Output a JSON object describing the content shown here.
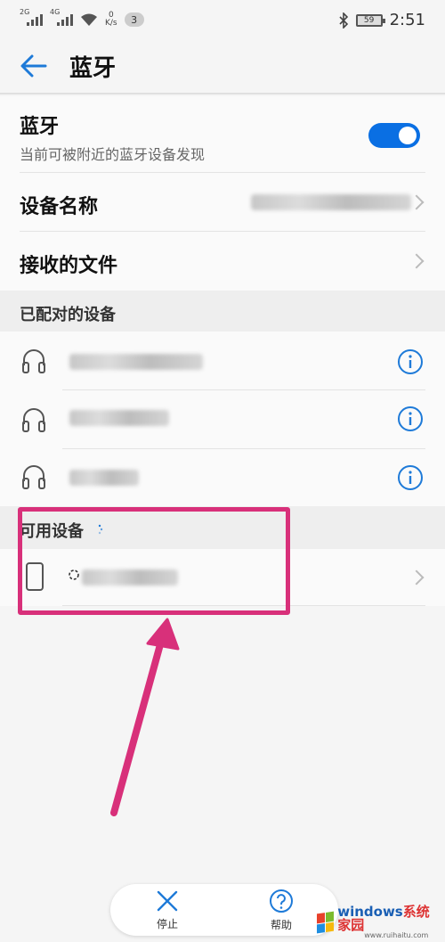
{
  "status_bar": {
    "net1": "2G",
    "net2": "4G",
    "speed_value": "0",
    "speed_unit": "K/s",
    "notification_count": "3",
    "battery": "59",
    "time": "2:51"
  },
  "app_bar": {
    "title": "蓝牙"
  },
  "bluetooth": {
    "title": "蓝牙",
    "subtitle": "当前可被附近的蓝牙设备发现",
    "enabled": true,
    "accent": "#0a6fe3"
  },
  "device_name_row": {
    "label": "设备名称"
  },
  "received_files_row": {
    "label": "接收的文件"
  },
  "paired_section": {
    "header": "已配对的设备"
  },
  "paired_devices": [
    {
      "icon": "headphones-icon"
    },
    {
      "icon": "headphones-icon"
    },
    {
      "icon": "headphones-icon"
    }
  ],
  "available_section": {
    "header": "可用设备"
  },
  "available_devices": [
    {
      "icon": "phone-icon"
    }
  ],
  "bottom_bar": {
    "stop_label": "停止",
    "help_label": "帮助"
  },
  "annotation": {
    "color": "#d8307a"
  },
  "watermark": {
    "brand": "windows",
    "brand_suffix": "系统家园",
    "url": "www.ruihaitu.com"
  }
}
